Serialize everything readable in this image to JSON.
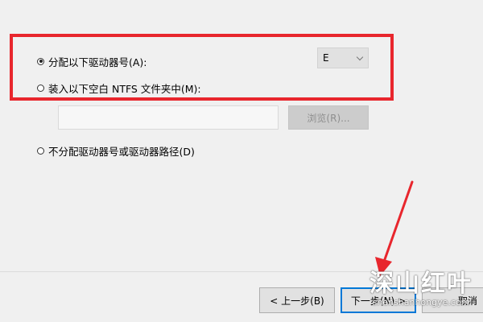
{
  "options": {
    "assign_letter": {
      "label": "分配以下驱动器号(A):",
      "checked": true
    },
    "mount_folder": {
      "label": "装入以下空白 NTFS 文件夹中(M):",
      "checked": false
    },
    "no_letter": {
      "label": "不分配驱动器号或驱动器路径(D)",
      "checked": false
    }
  },
  "drive_select": {
    "value": "E",
    "icon": "chevron-down-icon"
  },
  "folder_path": {
    "value": ""
  },
  "browse_button": {
    "label": "浏览(R)..."
  },
  "footer": {
    "back_label": "< 上一步(B)",
    "next_label": "下一步(N) >",
    "cancel_label": "取消"
  },
  "annotation": {
    "highlight_color": "#e8262d",
    "arrow_color": "#e8262d"
  },
  "watermark": {
    "title": "深山红叶",
    "url": "shenshanhongye.com"
  }
}
